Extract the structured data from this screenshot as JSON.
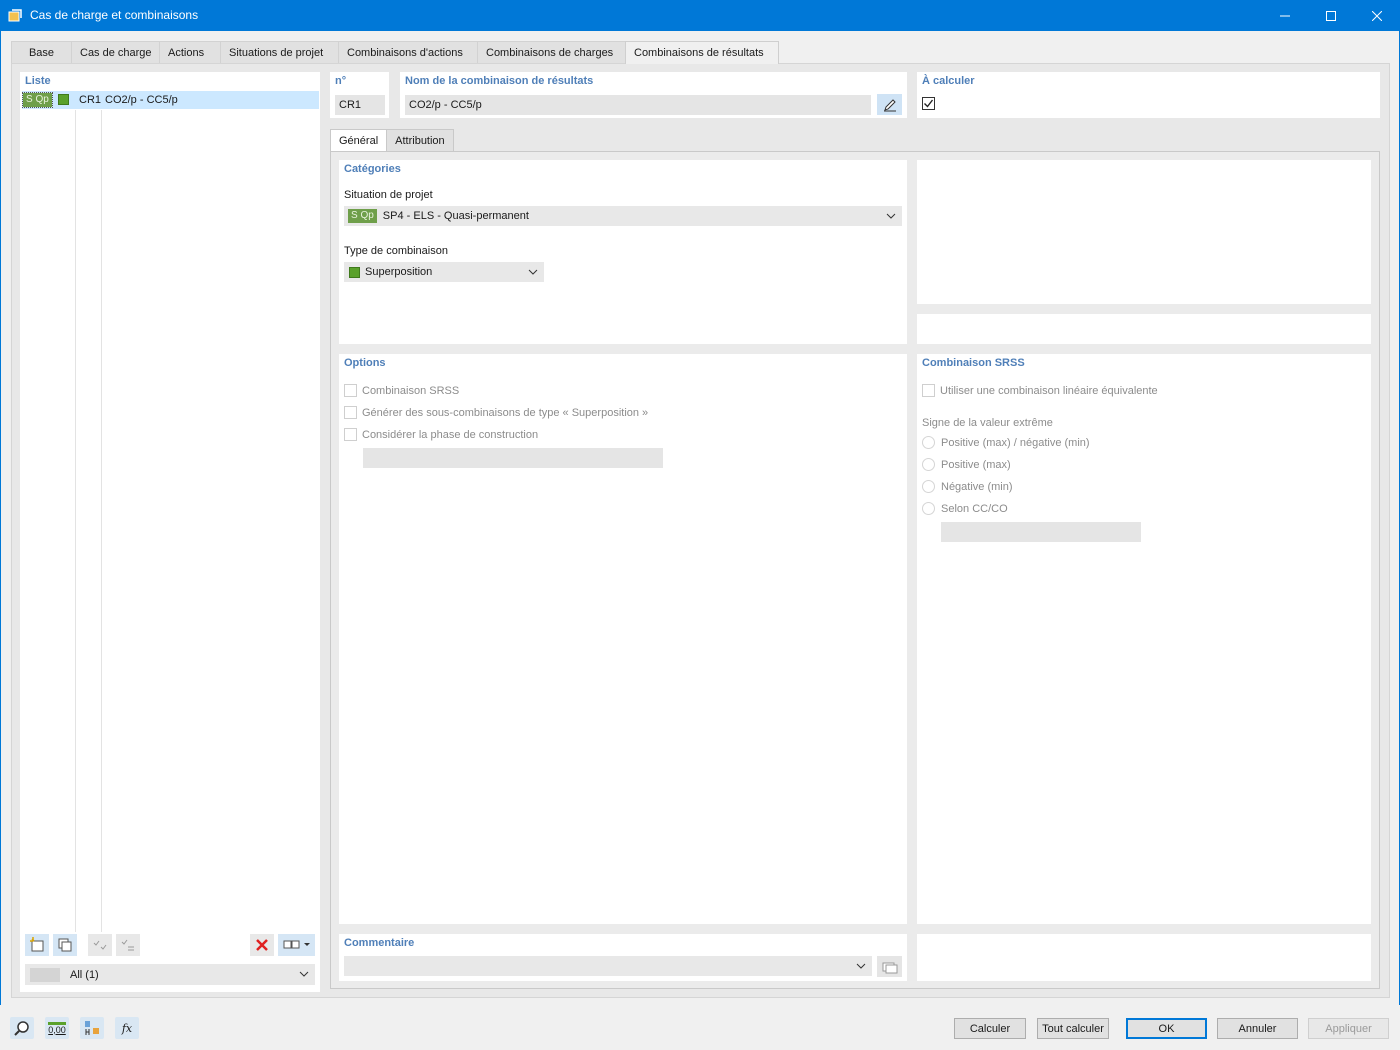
{
  "window": {
    "title": "Cas de charge et combinaisons",
    "app_icon": "rfem-app-icon",
    "controls": [
      "minimize-icon",
      "maximize-icon",
      "close-icon"
    ]
  },
  "tabs": [
    {
      "label": "Base",
      "active": false
    },
    {
      "label": "Cas de charge",
      "active": false
    },
    {
      "label": "Actions",
      "active": false
    },
    {
      "label": "Situations de projet",
      "active": false
    },
    {
      "label": "Combinaisons d'actions",
      "active": false
    },
    {
      "label": "Combinaisons de charges",
      "active": false
    },
    {
      "label": "Combinaisons de résultats",
      "active": true
    }
  ],
  "list": {
    "label": "Liste",
    "items": [
      {
        "badge": "S Qp",
        "number": "CR1",
        "name": "CO2/p - CC5/p",
        "color": "#5aa12b"
      }
    ],
    "filter": {
      "value": "All (1)"
    },
    "toolbar_icons": [
      "new-item-icon",
      "copy-item-icon",
      "check-all-icon",
      "uncheck-all-icon",
      "delete-icon",
      "view-options-icon"
    ]
  },
  "header": {
    "number_label": "n°",
    "number_value": "CR1",
    "name_label": "Nom de la combinaison de résultats",
    "name_value": "CO2/p - CC5/p",
    "calc_label": "À calculer",
    "calc_checked": true
  },
  "subtabs": [
    {
      "label": "Général",
      "active": true
    },
    {
      "label": "Attribution",
      "active": false
    }
  ],
  "categories": {
    "title": "Catégories",
    "situation_label": "Situation de projet",
    "situation_badge": "S Qp",
    "situation_value": "SP4 - ELS - Quasi-permanent",
    "type_label": "Type de combinaison",
    "type_value": "Superposition",
    "type_color": "#5aa12b"
  },
  "options": {
    "title": "Options",
    "items": [
      {
        "label": "Combinaison SRSS",
        "checked": false
      },
      {
        "label": "Générer des sous-combinaisons de type « Superposition »",
        "checked": false
      },
      {
        "label": "Considérer la phase de construction",
        "checked": false
      }
    ]
  },
  "srss": {
    "title": "Combinaison SRSS",
    "linear_label": "Utiliser une combinaison linéaire équivalente",
    "sign_label": "Signe de la valeur extrême",
    "radios": [
      {
        "label": "Positive (max) / négative (min)"
      },
      {
        "label": "Positive (max)"
      },
      {
        "label": "Négative (min)"
      },
      {
        "label": "Selon CC/CO"
      }
    ]
  },
  "comment": {
    "title": "Commentaire",
    "value": ""
  },
  "footer": {
    "tool_icons": [
      "search-help-icon",
      "decimal-places-icon",
      "units-icon",
      "formula-icon"
    ],
    "decimal_label": "0,00",
    "formula_label": "fx",
    "buttons": {
      "calculate": "Calculer",
      "calculate_all": "Tout calculer",
      "ok": "OK",
      "cancel": "Annuler",
      "apply": "Appliquer"
    }
  },
  "colors": {
    "accent": "#0078d7",
    "label_blue": "#4f7fb8",
    "badge_green": "#6f9f4a",
    "selection": "#cce8ff"
  }
}
